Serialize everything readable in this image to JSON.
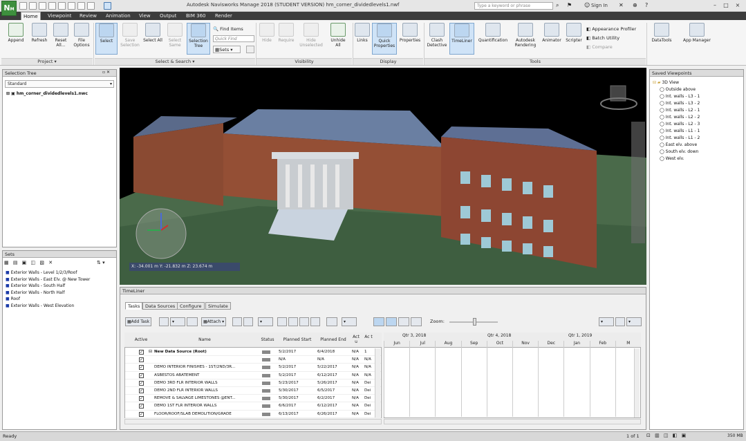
{
  "title": "Autodesk Navisworks Manage 2018 (STUDENT VERSION)    hm_corner_dividedlevels1.nwf",
  "search_placeholder": "Type a keyword or phrase",
  "sign_in": "Sign In",
  "menu_tabs": [
    "Home",
    "Viewpoint",
    "Review",
    "Animation",
    "View",
    "Output",
    "BIM 360",
    "Render"
  ],
  "ribbon": {
    "project": [
      "Append",
      "Refresh",
      "Reset All...",
      "File Options"
    ],
    "select": [
      "Select",
      "Save Selection",
      "Select All",
      "Select Same",
      "Selection Tree"
    ],
    "find_items": "Find Items",
    "quick_find": "Quick Find",
    "sets": "Sets",
    "visibility": [
      "Hide",
      "Require",
      "Hide Unselected",
      "Unhide All"
    ],
    "display": [
      "Links",
      "Quick Properties",
      "Properties"
    ],
    "tools": [
      "Clash Detective",
      "TimeLiner",
      "Quantification",
      "Autodesk Rendering",
      "Animator",
      "Scripter"
    ],
    "tools_small": [
      "Appearance Profiler",
      "Batch Utility",
      "Compare"
    ],
    "extra": [
      "DataTools",
      "App Manager"
    ],
    "groups": [
      "Project",
      "Select & Search",
      "Visibility",
      "Display",
      "Tools"
    ]
  },
  "selection_tree": {
    "title": "Selection Tree",
    "dropdown": "Standard",
    "root": "hm_corner_dividedlevels1.nwc"
  },
  "sets": {
    "title": "Sets",
    "items": [
      "Exterior Walls - Level 1/2/3/Roof",
      "Exterior Walls - East Elv. @ New Tower",
      "Exterior Walls - South Half",
      "Exterior Walls - North Half",
      "Roof",
      "Exterior Walls - West Elevation"
    ]
  },
  "saved_viewpoints": {
    "title": "Saved Viewpoints",
    "items": [
      "3D View",
      "Outside above",
      "Int. walls - L3 - 1",
      "Int. walls - L3 - 2",
      "Int. walls - L2 - 1",
      "Int. walls - L2 - 2",
      "Int. walls - L2 - 3",
      "Int. walls - L1 - 1",
      "Int. walls - L1 - 2",
      "East elv. above",
      "South elv. down",
      "West elv."
    ]
  },
  "viewport": {
    "coords": "X: -34.001 m   Y: -21.832 m   Z: 23.674 m"
  },
  "timeliner": {
    "title": "TimeLiner",
    "tabs": [
      "Tasks",
      "Data Sources",
      "Configure",
      "Simulate"
    ],
    "add_task": "Add Task",
    "attach": "Attach",
    "zoom_label": "Zoom:",
    "columns": [
      "Active",
      "Name",
      "Status",
      "Planned Start",
      "Planned End",
      "Act u",
      "Ac t"
    ],
    "rows": [
      {
        "name": "New Data Source (Root)",
        "start": "5/2/2017",
        "end": "6/4/2018",
        "a": "N/A",
        "b": "1"
      },
      {
        "name": "",
        "start": "N/A",
        "end": "N/A",
        "a": "N/A",
        "b": "N/A"
      },
      {
        "name": "DEMO INTERIOR FINISHES - 1ST/2ND/3R...",
        "start": "5/2/2017",
        "end": "5/22/2017",
        "a": "N/A",
        "b": "N/A"
      },
      {
        "name": "ASBESTOS ABATEMENT",
        "start": "5/2/2017",
        "end": "6/12/2017",
        "a": "N/A",
        "b": "N/A"
      },
      {
        "name": "DEMO 3RD FLR INTERIOR WALLS",
        "start": "5/23/2017",
        "end": "5/26/2017",
        "a": "N/A",
        "b": "Dei"
      },
      {
        "name": "DEMO 2ND FLR INTERIOR WALLS",
        "start": "5/30/2017",
        "end": "6/5/2017",
        "a": "N/A",
        "b": "Dei"
      },
      {
        "name": "REMOVE & SALVAGE LIMESTONES @ENT...",
        "start": "5/30/2017",
        "end": "6/2/2017",
        "a": "N/A",
        "b": "Dei"
      },
      {
        "name": "DEMO 1ST FLR INTERIOR WALLS",
        "start": "6/6/2017",
        "end": "6/12/2017",
        "a": "N/A",
        "b": "Dei"
      },
      {
        "name": "FLOOR/ROOF/SLAB DEMOLITION/GRADE",
        "start": "6/13/2017",
        "end": "6/26/2017",
        "a": "N/A",
        "b": "Dei"
      }
    ],
    "quarters": [
      "Qtr 3, 2018",
      "Qtr 4, 2018",
      "Qtr 1, 2019"
    ],
    "months": [
      "Jun",
      "Jul",
      "Aug",
      "Sep",
      "Oct",
      "Nov",
      "Dec",
      "Jan",
      "Feb",
      "M"
    ]
  },
  "status": {
    "left": "Ready",
    "page": "1 of 1",
    "mem": "350 MB"
  }
}
